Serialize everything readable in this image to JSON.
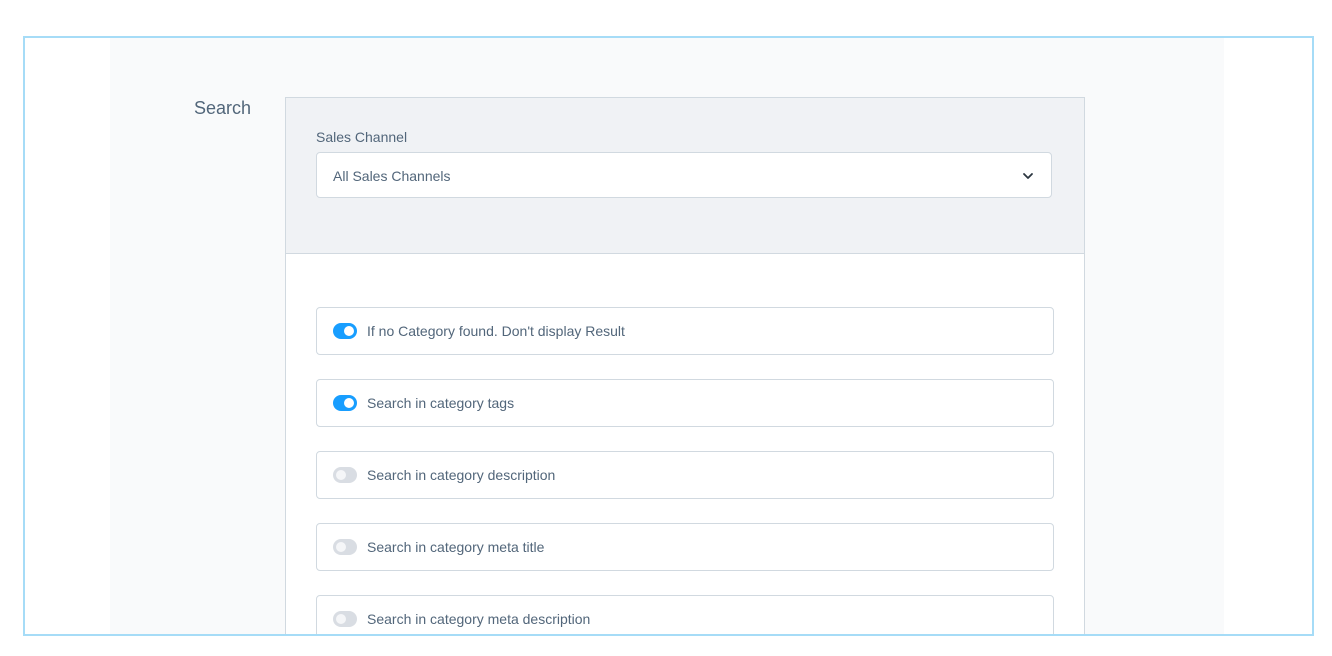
{
  "section": {
    "title": "Search"
  },
  "sales_channel": {
    "label": "Sales Channel",
    "selected": "All Sales Channels",
    "icon": "chevron-down-icon"
  },
  "options": [
    {
      "label": "If no Category found. Don't display Result",
      "enabled": true
    },
    {
      "label": "Search in category tags",
      "enabled": true
    },
    {
      "label": "Search in category description",
      "enabled": false
    },
    {
      "label": "Search in category meta title",
      "enabled": false
    },
    {
      "label": "Search in category meta description",
      "enabled": false
    }
  ],
  "colors": {
    "accent": "#189eff",
    "text": "#52667a",
    "border": "#d1d9e0",
    "frame": "#a6dcf7"
  }
}
